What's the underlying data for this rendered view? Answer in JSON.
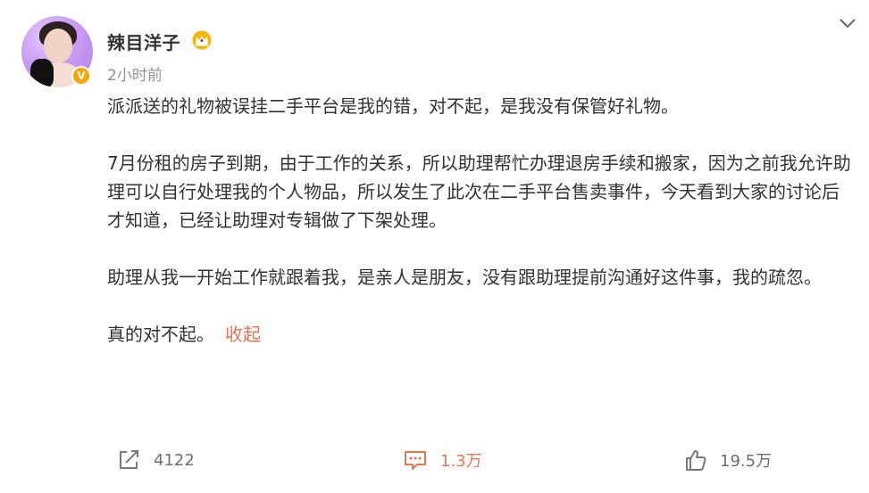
{
  "post": {
    "author": "辣目洋子",
    "time": "2小时前",
    "paragraphs": [
      "派派送的礼物被误挂二手平台是我的错，对不起，是我没有保管好礼物。",
      "7月份租的房子到期，由于工作的关系，所以助理帮忙办理退房手续和搬家，因为之前我允许助理可以自行处理我的个人物品，所以发生了此次在二手平台售卖事件，今天看到大家的讨论后才知道，已经让助理对专辑做了下架处理。",
      "助理从我一开始工作就跟着我，是亲人是朋友，没有跟助理提前沟通好这件事，我的疏忽。",
      "真的对不起。"
    ],
    "collapse_label": "收起"
  },
  "actions": {
    "repost_count": "4122",
    "comment_count": "1.3万",
    "like_count": "19.5万"
  },
  "icons": {
    "verified": "verified-v-badge-icon",
    "crown": "member-crown-icon",
    "menu": "chevron-down-icon",
    "repost": "repost-icon",
    "comment": "comment-icon",
    "like": "thumbs-up-icon"
  },
  "colors": {
    "accent": "#eb7350",
    "verified": "#f7a400",
    "text": "#333333",
    "meta": "#939393"
  }
}
